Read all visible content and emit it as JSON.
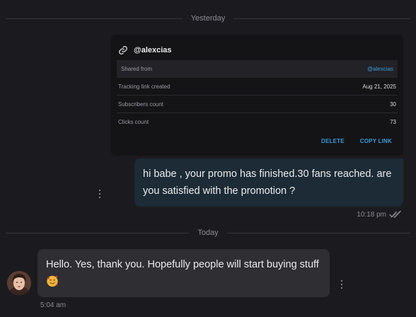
{
  "dividers": {
    "yesterday": "Yesterday",
    "today": "Today"
  },
  "tracking_card": {
    "handle": "@alexcias",
    "rows": [
      {
        "label": "Shared from",
        "value": "@alexcias"
      },
      {
        "label": "Tracking link created",
        "value": "Aug 21, 2025"
      },
      {
        "label": "Subscribers count",
        "value": "30"
      },
      {
        "label": "Clicks count",
        "value": "73"
      }
    ],
    "actions": {
      "delete": "DELETE",
      "copy": "COPY LINK"
    },
    "link_color": "#3b9bd8"
  },
  "messages": [
    {
      "direction": "outgoing",
      "text": "hi babe , your promo has finished.30 fans reached. are you satisfied with the promotion ?",
      "time": "10:18 pm",
      "status_icon": "double-check-icon"
    },
    {
      "direction": "incoming",
      "text": "Hello. Yes, thank you. Hopefully people will start buying stuff",
      "emoji_icon": "smiling-face-with-hearts-icon",
      "time": "5:04 am"
    }
  ],
  "colors": {
    "background": "#1b1b1f",
    "outgoing_bubble": "#1c2b35",
    "incoming_bubble": "#2e2e33"
  }
}
